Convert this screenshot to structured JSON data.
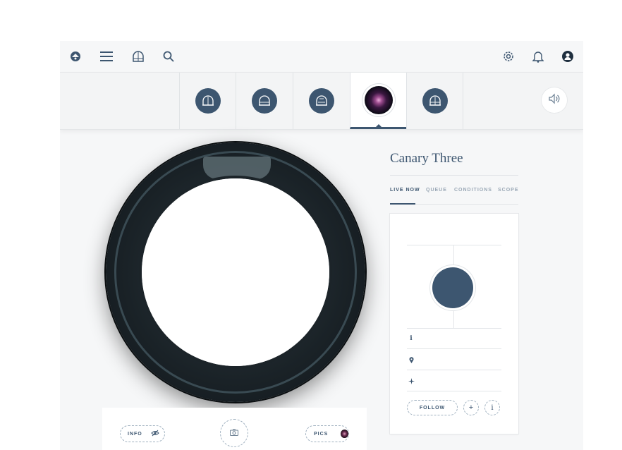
{
  "topbar": {
    "icons": [
      "logo-icon",
      "menu-icon",
      "observatory-icon",
      "search-icon",
      "gear-icon",
      "bell-icon",
      "user-icon"
    ]
  },
  "telescopes": {
    "tabs": [
      {
        "icon": "dome-icon",
        "active": false
      },
      {
        "icon": "dome-icon",
        "active": false
      },
      {
        "icon": "dome-icon",
        "active": false
      },
      {
        "icon": "galaxy-thumbnail",
        "active": true
      },
      {
        "icon": "dome-icon",
        "active": false
      }
    ],
    "sound_icon": "speaker-icon"
  },
  "observatory": {
    "title": "Canary Three",
    "subtabs": [
      "LIVE NOW",
      "QUEUE",
      "CONDITIONS",
      "SCOPE"
    ],
    "active_subtab": "LIVE NOW"
  },
  "card": {
    "rows": [
      {
        "icon": "info-icon"
      },
      {
        "icon": "location-icon"
      },
      {
        "icon": "target-icon"
      }
    ],
    "follow_label": "FOLLOW",
    "add_label": "+",
    "info_label": "i"
  },
  "controls": {
    "info_label": "INFO",
    "pics_label": "PICS"
  },
  "colors": {
    "accent": "#3d5670",
    "background": "#f6f7f8"
  }
}
